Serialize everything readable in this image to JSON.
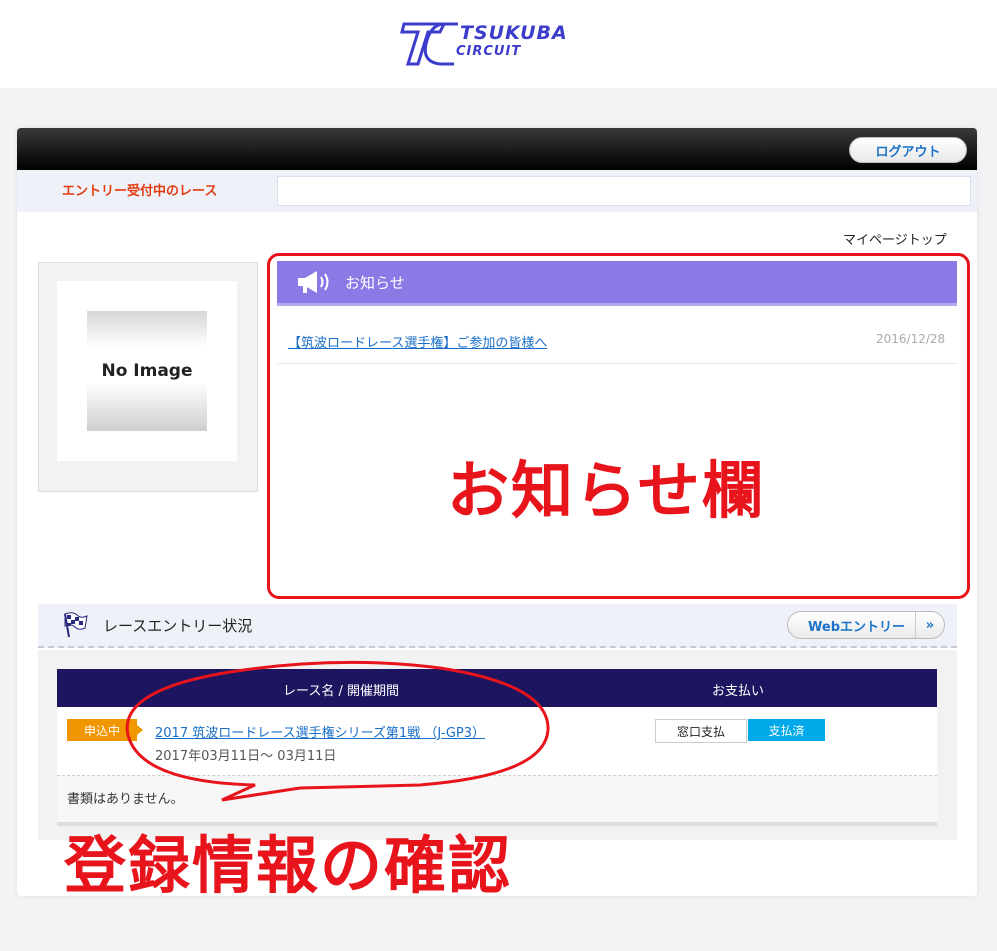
{
  "header": {
    "logo_line1": "TSUKUBA",
    "logo_line2": "CIRCUIT"
  },
  "topbar": {
    "logout_label": "ログアウト"
  },
  "entry_bar": {
    "label": "エントリー受付中のレース"
  },
  "mypage_link": "マイページトップ",
  "profile": {
    "placeholder": "No Image"
  },
  "notice": {
    "title": "お知らせ",
    "items": [
      {
        "title": "【筑波ロードレース選手権】ご参加の皆様へ",
        "date": "2016/12/28"
      }
    ]
  },
  "race_status": {
    "title": "レースエントリー状況",
    "web_entry_label": "Webエントリー",
    "web_entry_arrows": "»",
    "columns": [
      "レース名 / 開催期間",
      "お支払い"
    ],
    "rows": [
      {
        "badge": "申込中",
        "race_name": "2017 筑波ロードレース選手権シリーズ第1戦 （J-GP3）",
        "dates": "2017年03月11日～ 03月11日",
        "pay_method": "窓口支払",
        "pay_status": "支払済"
      }
    ],
    "docs_message": "書類はありません。"
  },
  "annotations": {
    "notice_area": "お知らせ欄",
    "registration": "登録情報の確認"
  },
  "colors": {
    "annotation_red": "#e8141c",
    "notice_header": "#8b7ae6",
    "table_header": "#1d1560",
    "badge_orange": "#f29600",
    "paid_blue": "#00a9e8"
  }
}
